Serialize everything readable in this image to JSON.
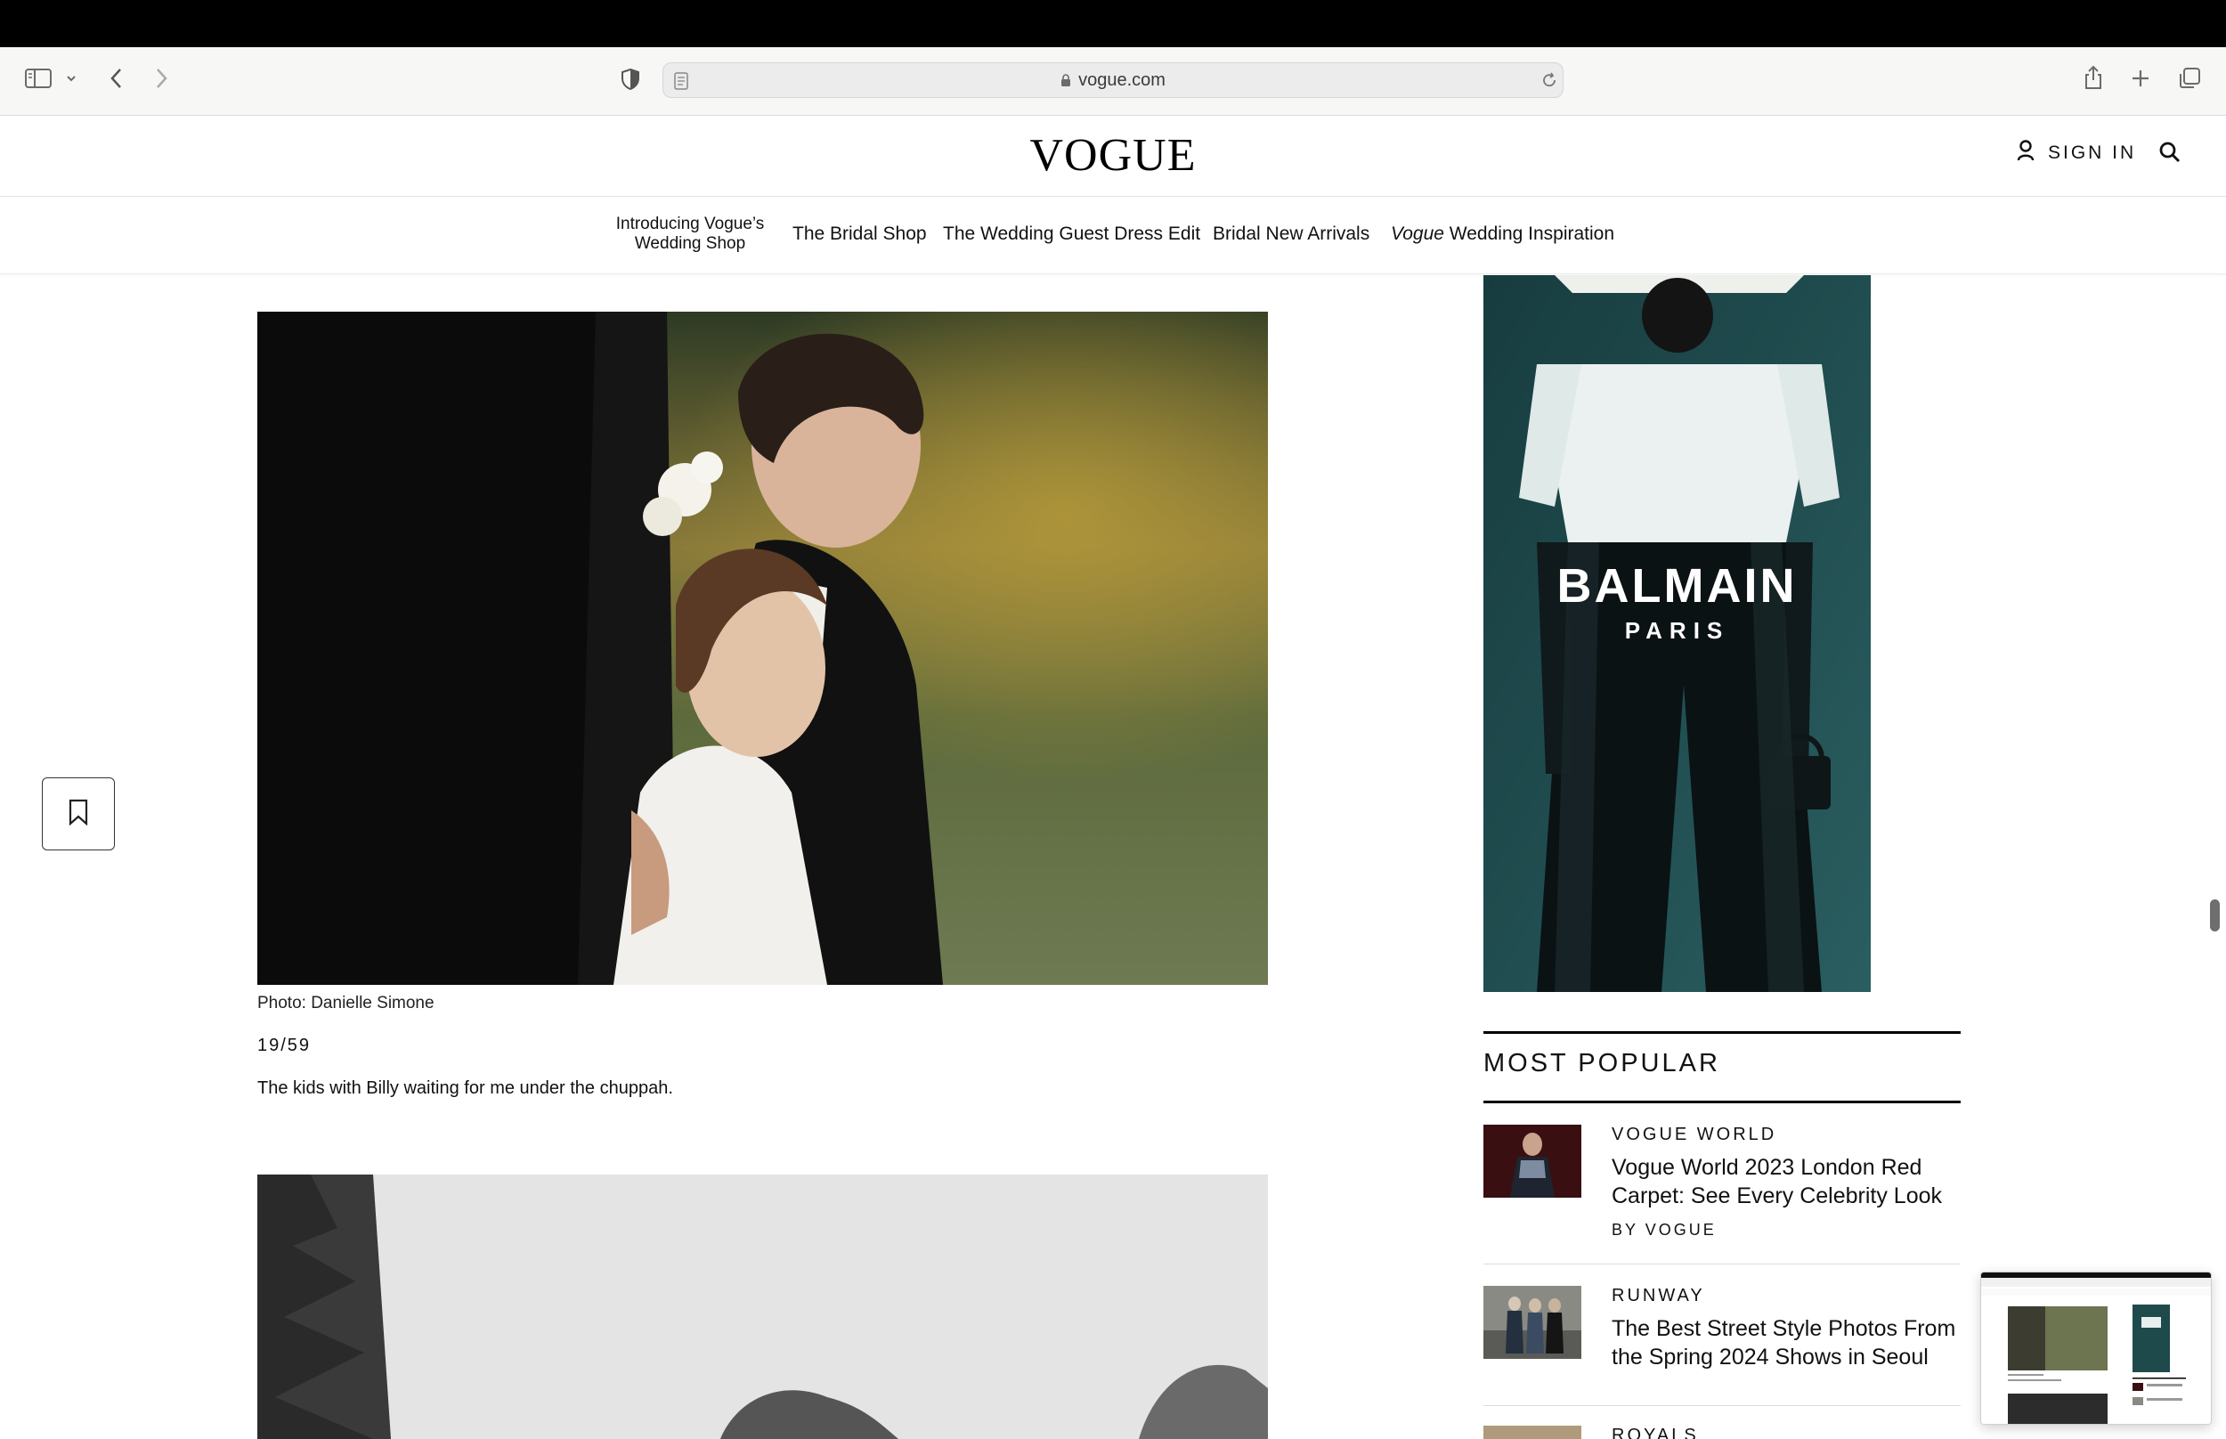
{
  "browser": {
    "url": "vogue.com",
    "icons": [
      "sidebar-icon",
      "chevron-down-icon",
      "back-icon",
      "forward-icon",
      "privacy-shield-icon",
      "reader-icon",
      "lock-icon",
      "reload-icon",
      "share-icon",
      "new-tab-icon",
      "tabs-overview-icon"
    ]
  },
  "header": {
    "logo": "VOGUE",
    "sign_in": "SIGN IN",
    "icons": [
      "person-icon",
      "search-icon"
    ]
  },
  "nav": {
    "items": [
      {
        "line1": "Introducing Vogue’s",
        "line2": "Wedding Shop"
      },
      {
        "label": "The Bridal Shop"
      },
      {
        "label": "The Wedding Guest Dress Edit"
      },
      {
        "label": "Bridal New Arrivals"
      },
      {
        "italic": "Vogue",
        "label": "Wedding Inspiration"
      }
    ]
  },
  "article": {
    "caption": "Photo: Danielle Simone",
    "counter": "19/59",
    "description": "The kids with Billy waiting for me under the chuppah."
  },
  "ad": {
    "brand": "BALMAIN",
    "sub": "PARIS"
  },
  "most_popular": {
    "title": "MOST POPULAR",
    "items": [
      {
        "category": "VOGUE WORLD",
        "headline": "Vogue World 2023 London Red Carpet: See Every Celebrity Look",
        "byline": "BY VOGUE"
      },
      {
        "category": "RUNWAY",
        "headline": "The Best Street Style Photos From the Spring 2024 Shows in Seoul"
      },
      {
        "category": "ROYALS"
      }
    ]
  },
  "colors": {
    "topbar": "#000000",
    "toolbar": "#f7f7f6",
    "ad_background": "#1f4a4c"
  }
}
